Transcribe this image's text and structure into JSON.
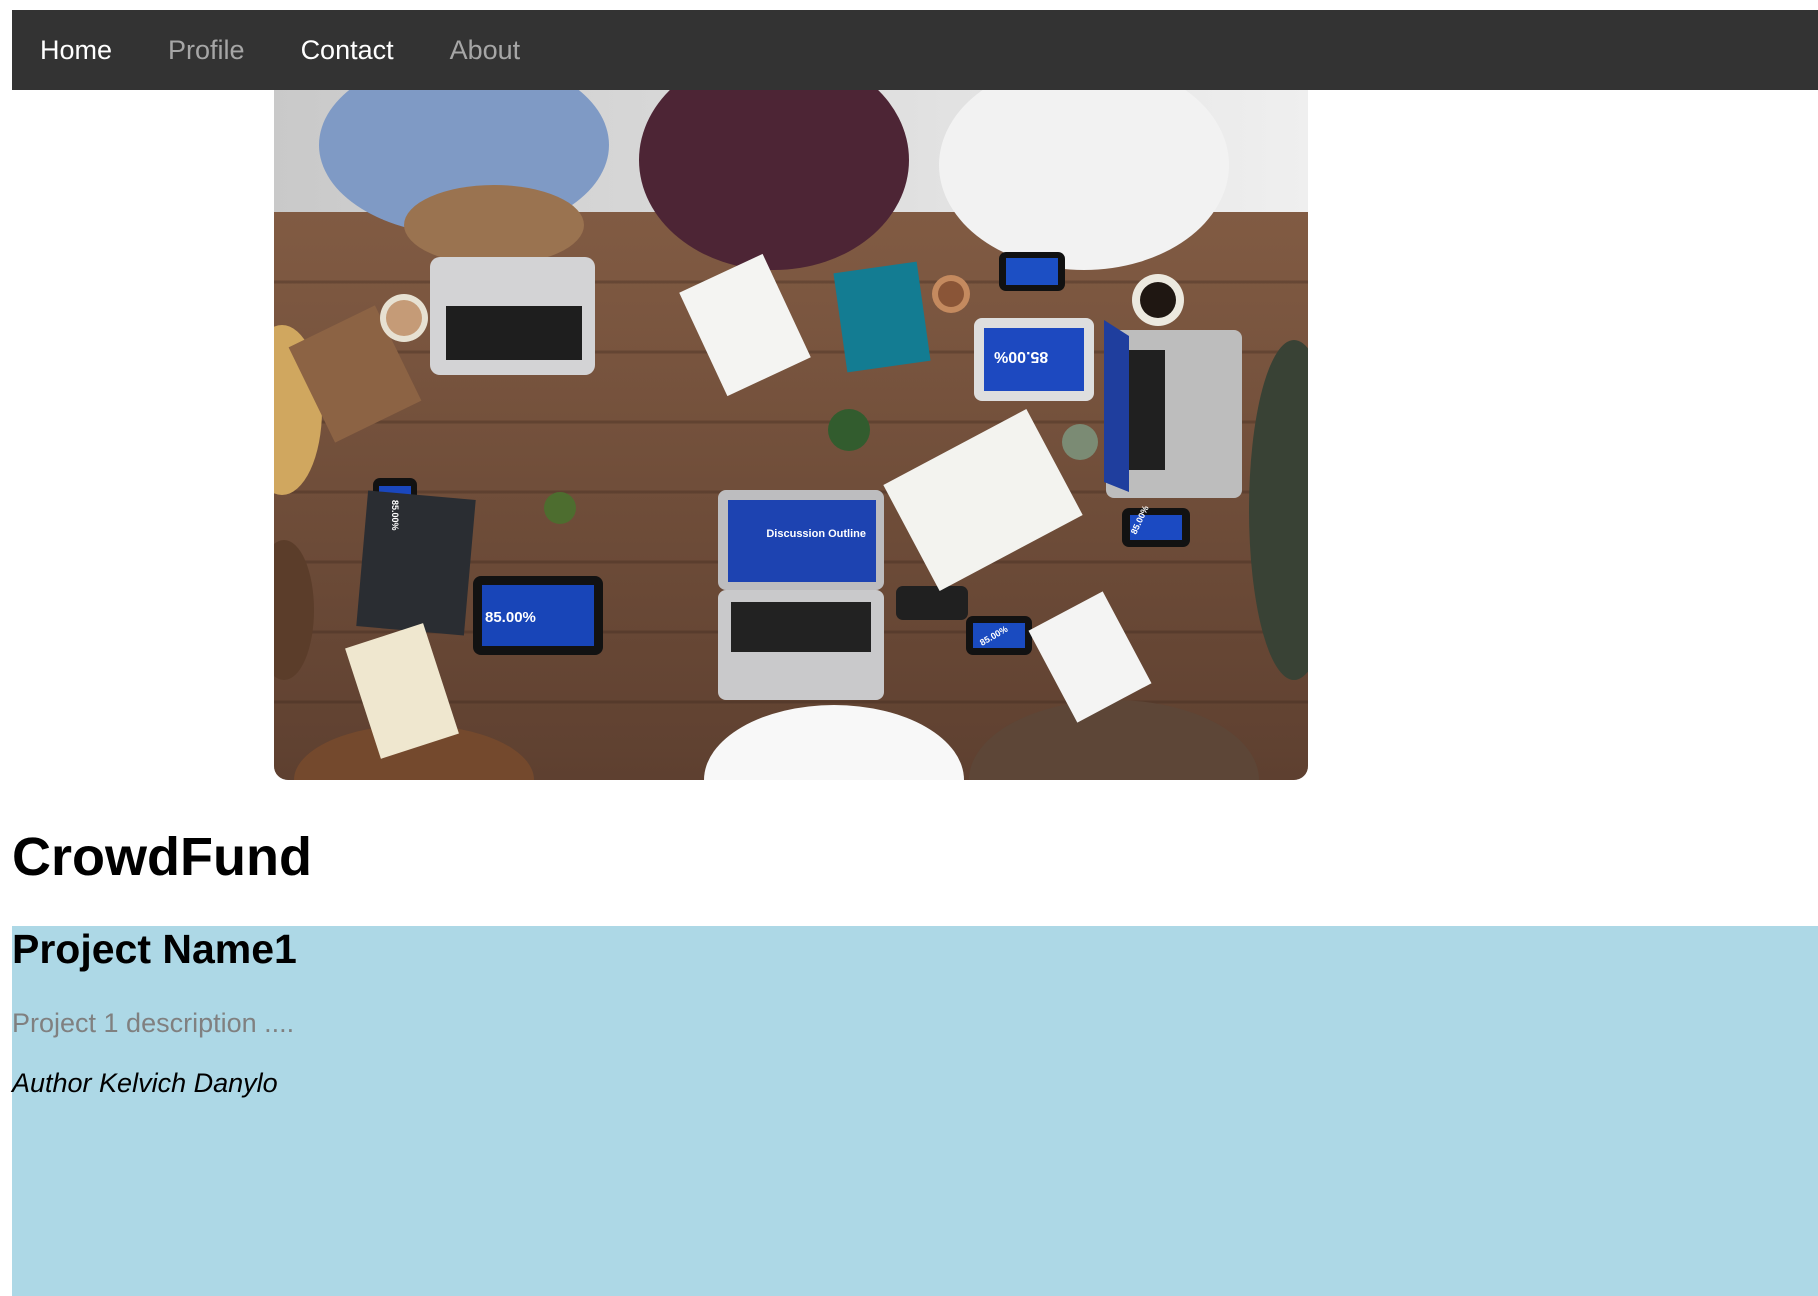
{
  "navbar": {
    "links": [
      {
        "label": "Home",
        "active": true
      },
      {
        "label": "Profile",
        "active": false
      },
      {
        "label": "Contact",
        "active": true
      },
      {
        "label": "About",
        "active": false
      }
    ]
  },
  "hero": {
    "image": {
      "subject": "team-meeting-overhead-photo",
      "screen_texts": [
        "85.00%",
        "85.00%",
        "85.00%",
        "85.00%",
        "85.00%",
        "Discussion Outline"
      ]
    }
  },
  "main": {
    "site_title": "CrowdFund",
    "projects": [
      {
        "name": "Project Name1",
        "description": "Project 1 description ....",
        "author": "Author Kelvich Danylo"
      }
    ]
  },
  "colors": {
    "navbar_bg": "#333333",
    "nav_active": "#ffffff",
    "nav_inactive": "#a6a6a6",
    "project_card_bg": "#add8e6",
    "description_text": "#808080"
  }
}
